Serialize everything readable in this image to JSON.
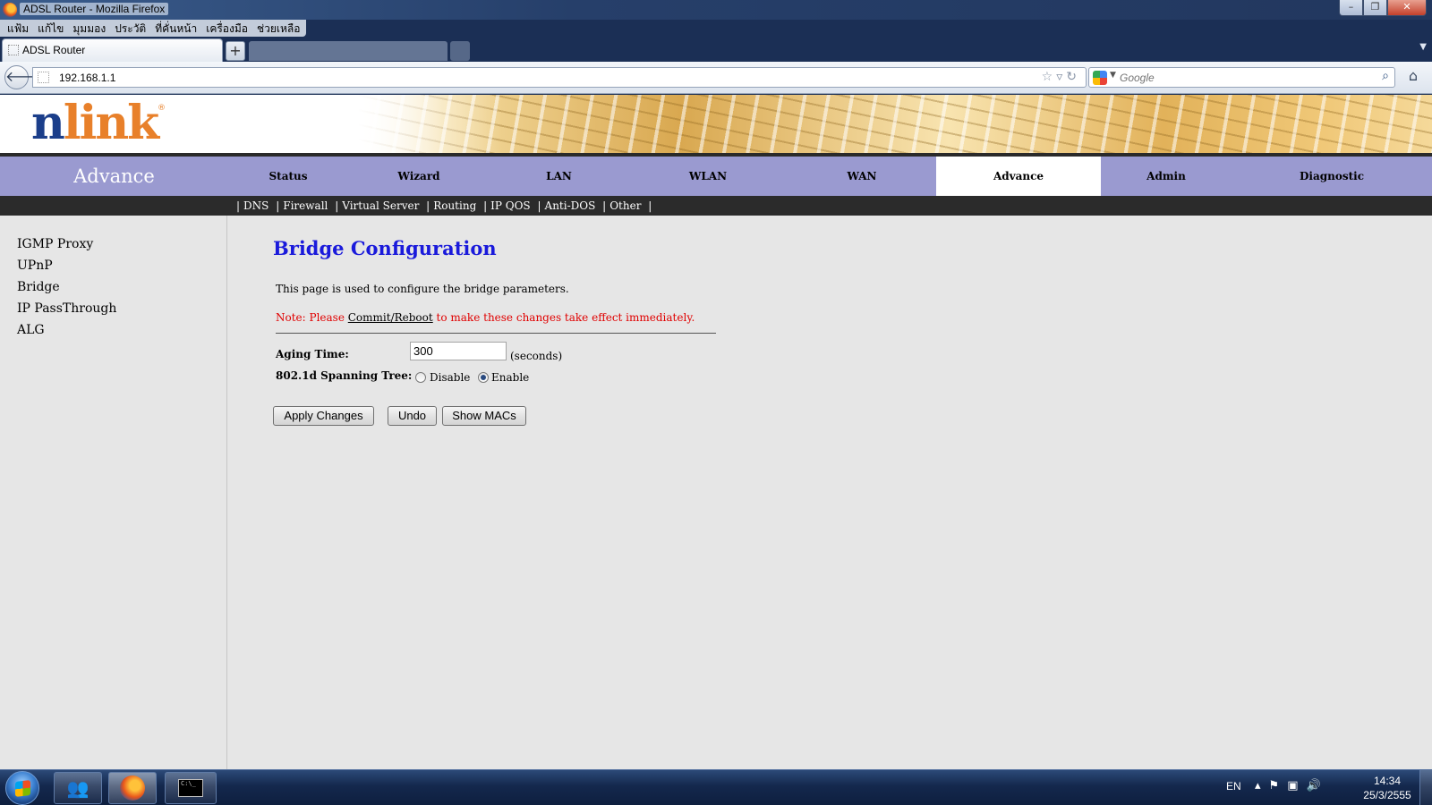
{
  "window": {
    "title": "ADSL Router - Mozilla Firefox",
    "minimize": "–",
    "maximize": "❐",
    "close": "✕"
  },
  "menu": [
    "แฟ้ม",
    "แก้ไข",
    "มุมมอง",
    "ประวัติ",
    "ที่คั่นหน้า",
    "เครื่องมือ",
    "ช่วยเหลือ"
  ],
  "tab": {
    "label": "ADSL Router",
    "new_tab": "+"
  },
  "navbar": {
    "url": "192.168.1.1",
    "search_placeholder": "Google"
  },
  "brand": {
    "logo_n": "n",
    "logo_rest": "link",
    "reg": "®"
  },
  "mainnav": {
    "section": "Advance",
    "items": [
      "Status",
      "Wizard",
      "LAN",
      "WLAN",
      "WAN",
      "Advance",
      "Admin",
      "Diagnostic"
    ],
    "active": "Advance"
  },
  "subnav": [
    "DNS",
    "Firewall",
    "Virtual Server",
    "Routing",
    "IP QOS",
    "Anti-DOS",
    "Other"
  ],
  "sidebar": [
    "IGMP Proxy",
    "UPnP",
    "Bridge",
    "IP PassThrough",
    "ALG"
  ],
  "content": {
    "title": "Bridge Configuration",
    "description": "This page is used to configure the bridge parameters.",
    "note_prefix": "Note: Please ",
    "note_link": "Commit/Reboot",
    "note_suffix": " to make these changes take effect immediately.",
    "aging_label": "Aging Time:",
    "aging_value": "300",
    "aging_unit": "(seconds)",
    "stp_label": "802.1d Spanning Tree:",
    "stp_options": [
      "Disable",
      "Enable"
    ],
    "stp_selected": "Enable",
    "buttons": {
      "apply": "Apply Changes",
      "undo": "Undo",
      "show_macs": "Show MACs"
    }
  },
  "taskbar": {
    "lang": "EN",
    "time": "14:34",
    "date": "25/3/2555"
  },
  "colors": {
    "nav_bg": "#9a9ad0",
    "title_blue": "#1a1adb",
    "note_red": "#e00000",
    "logo_blue": "#1b3e8a",
    "logo_orange": "#e8802a"
  }
}
